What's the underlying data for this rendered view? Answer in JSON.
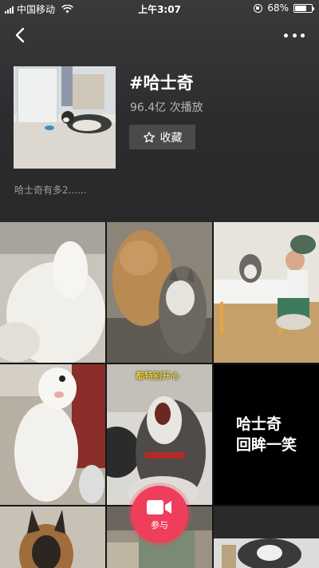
{
  "status_bar": {
    "carrier": "中国移动",
    "time": "上午3:07",
    "battery": "68%",
    "battery_level": 0.68,
    "icons": [
      "signal-icon",
      "wifi-icon",
      "orientation-lock-icon",
      "battery-icon"
    ]
  },
  "nav": {
    "back_icon": "chevron-left-icon",
    "more_icon": "more-dots-icon"
  },
  "topic": {
    "title": "#哈士奇",
    "play_count": "96.4亿 次播放",
    "favorite_label": "收藏",
    "favorite_icon": "star-outline-icon",
    "description": "哈士奇有多2......"
  },
  "grid": {
    "tiles": [
      {
        "name": "video-tile-1"
      },
      {
        "name": "video-tile-2"
      },
      {
        "name": "video-tile-3"
      },
      {
        "name": "video-tile-4"
      },
      {
        "name": "video-tile-5",
        "overlay_text": "都特别开心"
      },
      {
        "name": "video-tile-6",
        "caption_line1": "哈士奇",
        "caption_line2": "回眸一笑"
      },
      {
        "name": "video-tile-7"
      },
      {
        "name": "video-tile-8"
      },
      {
        "name": "video-tile-9"
      }
    ]
  },
  "join_button": {
    "label": "参与",
    "icon": "video-camera-icon",
    "color": "#ee3e5c"
  }
}
